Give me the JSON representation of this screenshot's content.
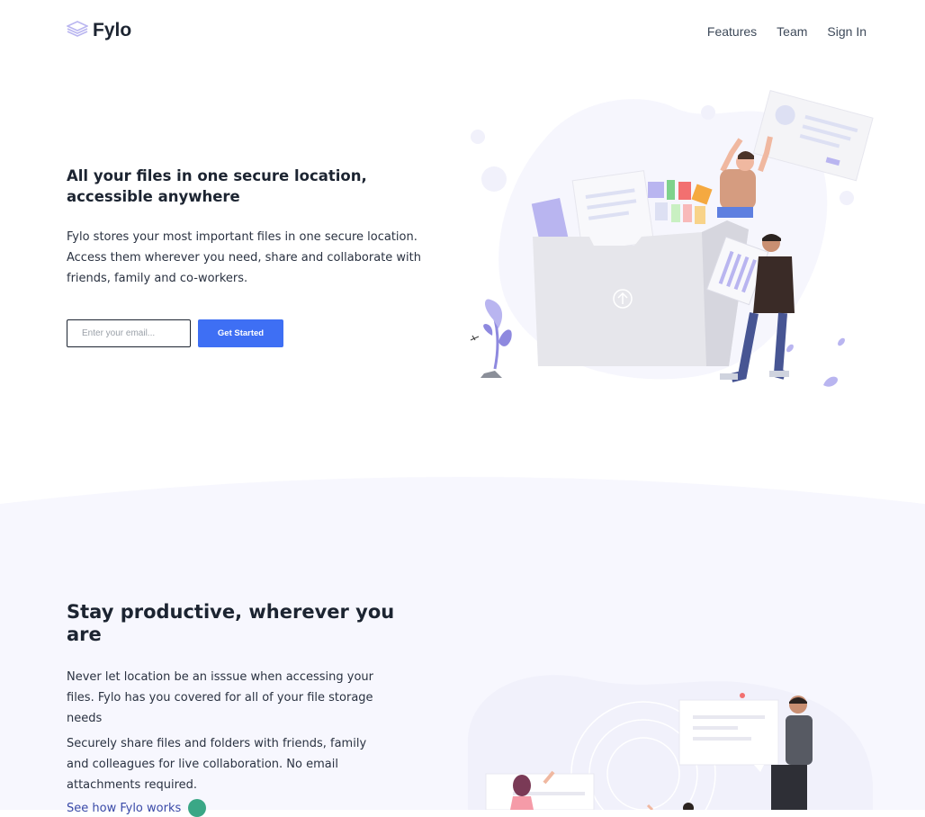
{
  "header": {
    "logo_text": "Fylo",
    "nav": [
      "Features",
      "Team",
      "Sign In"
    ]
  },
  "hero": {
    "title": "All your files in one secure location, accessible anywhere",
    "text": "Fylo stores your most important files in one secure location. Access them wherever you need, share and collaborate with friends, family and co-workers.",
    "email_placeholder": "Enter your email...",
    "button_label": "Get Started"
  },
  "productive": {
    "title": "Stay productive, wherever you are",
    "paragraph1": "Never let location be an isssue when accessing your files. Fylo has you covered for all of your file storage needs",
    "paragraph2": "Securely share files and folders with friends, family and colleagues for live collaboration. No email attachments required.",
    "link_label": "See how Fylo works"
  },
  "colors": {
    "accent_blue": "#3e6ff4",
    "section_bg": "#f7f7fe",
    "dark_text": "#1c2431",
    "link_green": "#3aa786"
  }
}
